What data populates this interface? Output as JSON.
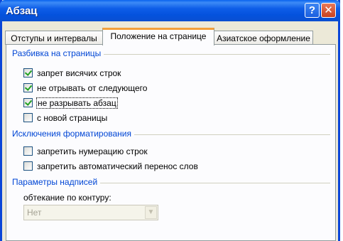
{
  "window": {
    "title": "Абзац",
    "help_label": "?",
    "close_label": "✕",
    "accent": "#0b46d8"
  },
  "tabs": [
    {
      "label": "Отступы и интервалы",
      "active": false
    },
    {
      "label": "Положение на странице",
      "active": true
    },
    {
      "label": "Азиатское оформление",
      "active": false
    }
  ],
  "pagination": {
    "heading": "Разбивка на страницы",
    "items": [
      {
        "label": "запрет висячих строк",
        "checked": true
      },
      {
        "label": "не отрывать от следующего",
        "checked": true
      },
      {
        "label": "не разрывать абзац",
        "checked": true
      },
      {
        "label": "с новой страницы",
        "checked": false
      }
    ]
  },
  "exceptions": {
    "heading": "Исключения форматирования",
    "items": [
      {
        "label": "запретить нумерацию строк",
        "checked": false
      },
      {
        "label": "запретить автоматический перенос слов",
        "checked": false
      }
    ]
  },
  "textbox": {
    "heading": "Параметры надписей",
    "wrap_label": "обтекание по контуру:",
    "wrap_value": "Нет"
  }
}
